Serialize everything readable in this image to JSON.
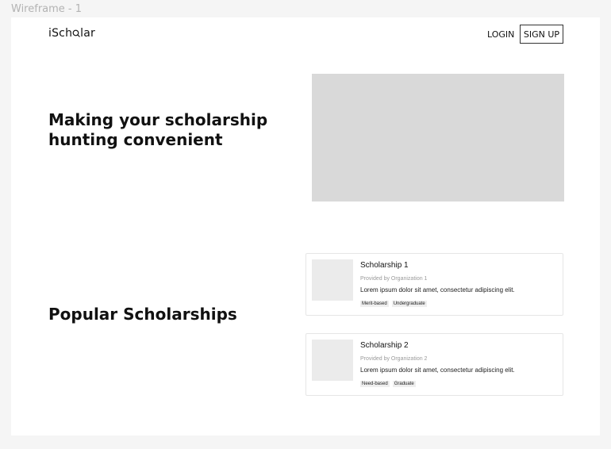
{
  "frame": {
    "label": "Wireframe - 1"
  },
  "header": {
    "logo": "iSchQlar",
    "logo_parts": {
      "before": "iSch",
      "q": "Q",
      "after": "lar"
    },
    "login_label": "LOGIN",
    "signup_label": "SIGN UP"
  },
  "hero": {
    "title_line1": "Making your scholarship",
    "title_line2": "hunting convenient"
  },
  "popular": {
    "title": "Popular Scholarships",
    "cards": [
      {
        "title": "Scholarship 1",
        "provider": "Provided by Organization 1",
        "description": "Lorem ipsum dolor sit amet, consectetur adipiscing elit.",
        "tags": [
          "Merit-based",
          "Undergraduate"
        ]
      },
      {
        "title": "Scholarship 2",
        "provider": "Provided by Organization 2",
        "description": "Lorem ipsum dolor sit amet, consectetur adipiscing elit.",
        "tags": [
          "Need-based",
          "Graduate"
        ]
      }
    ]
  },
  "colors": {
    "canvas": "#f5f5f5",
    "frame": "#ffffff",
    "placeholder": "#d9d9d9",
    "thumbnail": "#ebebeb"
  }
}
